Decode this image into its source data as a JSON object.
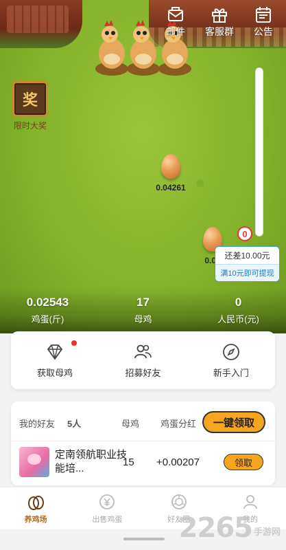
{
  "top_bar": {
    "mail_label": "邮件",
    "service_label": "客服群",
    "notice_label": "公告"
  },
  "prize": {
    "icon_text": "奖",
    "label": "限时大奖"
  },
  "eggs": [
    {
      "value": "0.04261"
    },
    {
      "value": "0.04"
    }
  ],
  "progress": {
    "knob_value": "0",
    "fraction": 0.0,
    "tip_line1": "还差10.00元",
    "tip_line2": "满10元即可提现"
  },
  "stats": {
    "eggs_value": "0.02543",
    "eggs_label": "鸡蛋(斤)",
    "hens_value": "17",
    "hens_label": "母鸡",
    "rmb_value": "0",
    "rmb_label": "人民币(元)"
  },
  "actions": {
    "get_hen": "获取母鸡",
    "recruit": "招募好友",
    "guide": "新手入门"
  },
  "friends": {
    "title": "我的好友",
    "count": "5人",
    "col_hens": "母鸡",
    "col_dividend": "鸡蛋分红",
    "claim_all": "一键领取",
    "rows": [
      {
        "name": "定南领航职业技能培...",
        "hens": "15",
        "dividend": "+0.00207",
        "claim": "领取"
      }
    ]
  },
  "nav": {
    "items": [
      {
        "label": "养鸡场",
        "icon": "egg-icon",
        "active": true
      },
      {
        "label": "出售鸡蛋",
        "icon": "yuan-icon",
        "active": false
      },
      {
        "label": "好友圈",
        "icon": "circle-icon",
        "active": false
      },
      {
        "label": "我的",
        "icon": "user-icon",
        "active": false
      }
    ]
  },
  "watermark": {
    "number": "2265",
    "text": "手游网"
  },
  "colors": {
    "accent": "#f6a51f",
    "grass": "#84b22a",
    "active_nav": "#b46a1a",
    "tip_blue": "#3aa0d8"
  }
}
